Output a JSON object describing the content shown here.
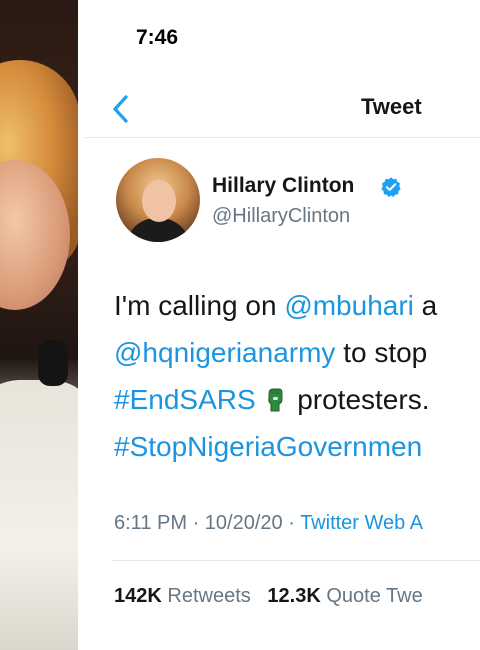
{
  "status_bar": {
    "time": "7:46"
  },
  "nav": {
    "title": "Tweet",
    "back_icon": "chevron-left-icon"
  },
  "author": {
    "name": "Hillary Clinton",
    "handle": "@HillaryClinton",
    "verified": true
  },
  "tweet": {
    "line1_text": "I'm calling on ",
    "mention1": "@mbuhari",
    "line1_tail": " a",
    "mention2": "@hqnigerianarmy",
    "line2_tail": " to stop",
    "hashtag1": "#EndSARS",
    "line3_tail": " protesters.",
    "hashtag2": "#StopNigeriaGovernmen"
  },
  "meta": {
    "time": "6:11 PM",
    "date": "10/20/20",
    "source": "Twitter Web A"
  },
  "stats": {
    "retweets_count": "142K",
    "retweets_label": "Retweets",
    "quotes_count": "12.3K",
    "quotes_label": "Quote Twe"
  },
  "colors": {
    "link": "#1b95e0",
    "secondary_text": "#657786",
    "primary_text": "#14171a",
    "verified": "#1da1f2",
    "fist_emoji": "#2e8b3e"
  }
}
